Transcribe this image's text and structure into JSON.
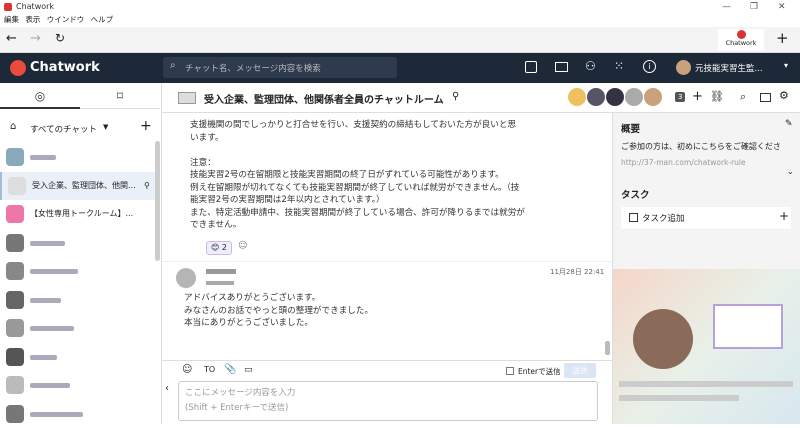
{
  "window": {
    "title": "Chatwork"
  },
  "menu": [
    "編集",
    "表示",
    "ウインドウ",
    "ヘルプ"
  ],
  "header": {
    "logo": "Chatwork",
    "search_placeholder": "チャット名、メッセージ内容を検索",
    "username": "元技能実習生監...",
    "tab_label": "Chatwork"
  },
  "sidebar": {
    "filter_label": "すべてのチャット",
    "rooms": [
      {
        "name": "",
        "selected": false
      },
      {
        "name": "受入企業、監理団体、他関...",
        "selected": true
      },
      {
        "name": "【女性専用トークルーム】...",
        "selected": false
      },
      {
        "name": "",
        "selected": false
      },
      {
        "name": "",
        "selected": false
      },
      {
        "name": "",
        "selected": false
      },
      {
        "name": "",
        "selected": false
      },
      {
        "name": "",
        "selected": false
      },
      {
        "name": "",
        "selected": false
      },
      {
        "name": "",
        "selected": false
      }
    ]
  },
  "room": {
    "title": "受入企業、監理団体、他関係者全員のチャットルーム",
    "member_count": "3"
  },
  "messages": {
    "m1_lines": [
      "支援機関の間でしっかりと打合せを行い、支援契約の締結もしておいた方が良いと思",
      "います。",
      "",
      "注意：",
      "技能実習2号の在留期限と技能実習期間の終了日がずれている可能性があります。",
      "例え在留期限が切れてなくても技能実習期間が終了していれば就労ができません。（技",
      "能実習2号の実習期間は2年以内とされています。）",
      "また、特定活動申請中、技能実習期間が終了している場合、許可が降りるまでは就労が",
      "できません。"
    ],
    "reaction_count": "2",
    "m2_date": "11月28日 22:41",
    "m2_lines": [
      "アドバイスありがとうございます。",
      "みなさんのお話でやっと頭の整理ができました。",
      "本当にありがとうございました。"
    ]
  },
  "composer": {
    "to_label": "TO",
    "enter_label": "Enterで送信",
    "send_label": "送信",
    "placeholder_line1": "ここにメッセージ内容を入力",
    "placeholder_line2": "(Shift + Enterキーで送信)"
  },
  "panel": {
    "overview_title": "概要",
    "overview_text": "ご参加の方は、初めにこちらをご確認くださ",
    "overview_link": "http://37-man.com/chatwork-rule",
    "task_title": "タスク",
    "task_add": "タスク追加"
  }
}
